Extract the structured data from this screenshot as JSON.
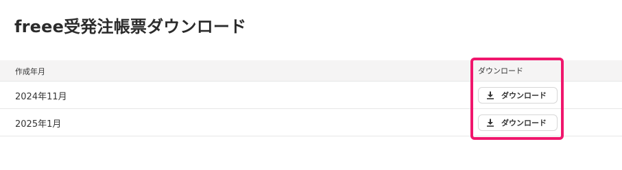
{
  "page": {
    "title": "freee受発注帳票ダウンロード"
  },
  "table": {
    "headers": {
      "month": "作成年月",
      "download": "ダウンロード"
    },
    "rows": [
      {
        "month": "2024年11月",
        "button_label": "ダウンロード",
        "icon": "download-icon"
      },
      {
        "month": "2025年1月",
        "button_label": "ダウンロード",
        "icon": "download-icon"
      }
    ]
  },
  "colors": {
    "highlight": "#f0166c",
    "header_background": "#f5f4f4",
    "row_border": "#e6e6e6"
  }
}
